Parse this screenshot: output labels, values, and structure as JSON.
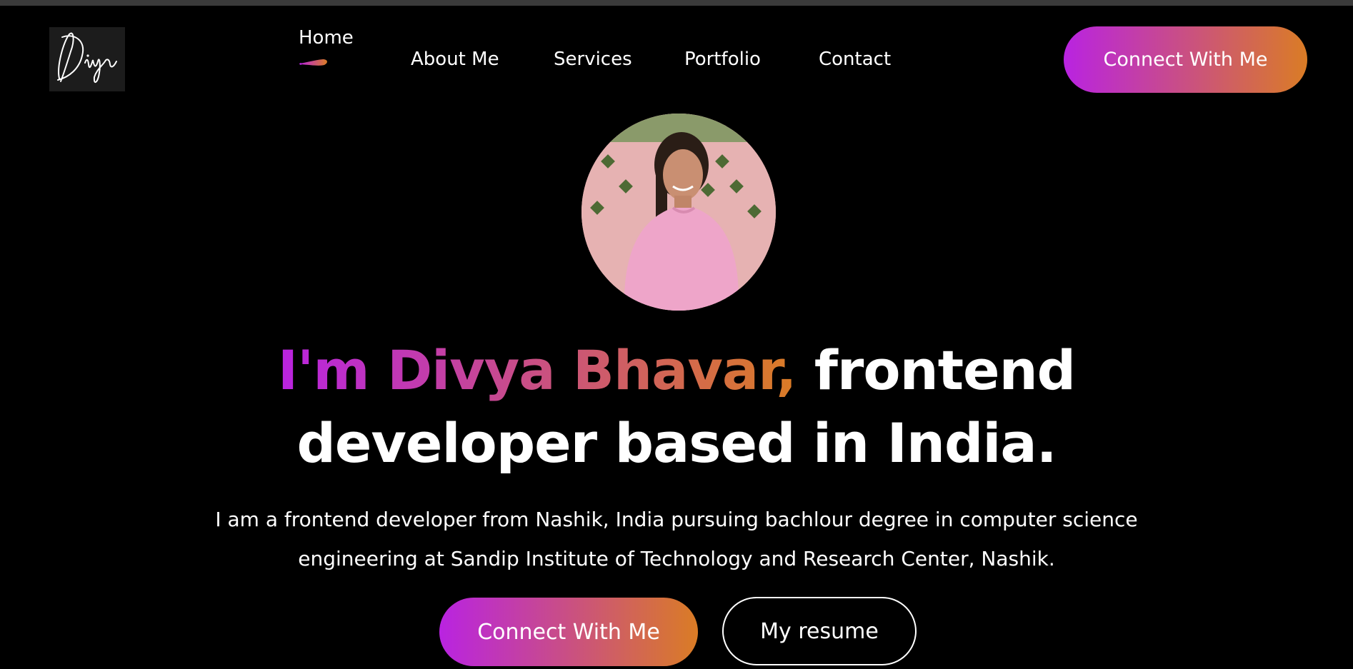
{
  "nav": {
    "items": [
      {
        "label": "Home",
        "active": true
      },
      {
        "label": "About Me"
      },
      {
        "label": "Services"
      },
      {
        "label": "Portfolio"
      },
      {
        "label": "Contact"
      }
    ],
    "cta_label": "Connect With Me"
  },
  "hero": {
    "headline_highlight": "I'm Divya Bhavar,",
    "headline_line1_rest": " frontend",
    "headline_line2": "developer based in India.",
    "bio_line1": "I am a frontend developer from Nashik, India pursuing bachlour degree in computer science",
    "bio_line2": "engineering at Sandip Institute of Technology and Research Center, Nashik.",
    "primary_cta": "Connect With Me",
    "secondary_cta": "My resume"
  },
  "theme": {
    "background": "#000000",
    "gradient_start": "#b923e1",
    "gradient_end": "#da7c25",
    "text": "#ffffff"
  },
  "icons": {
    "logo": "signature-logo-icon",
    "active_indicator": "brush-stroke-icon"
  }
}
